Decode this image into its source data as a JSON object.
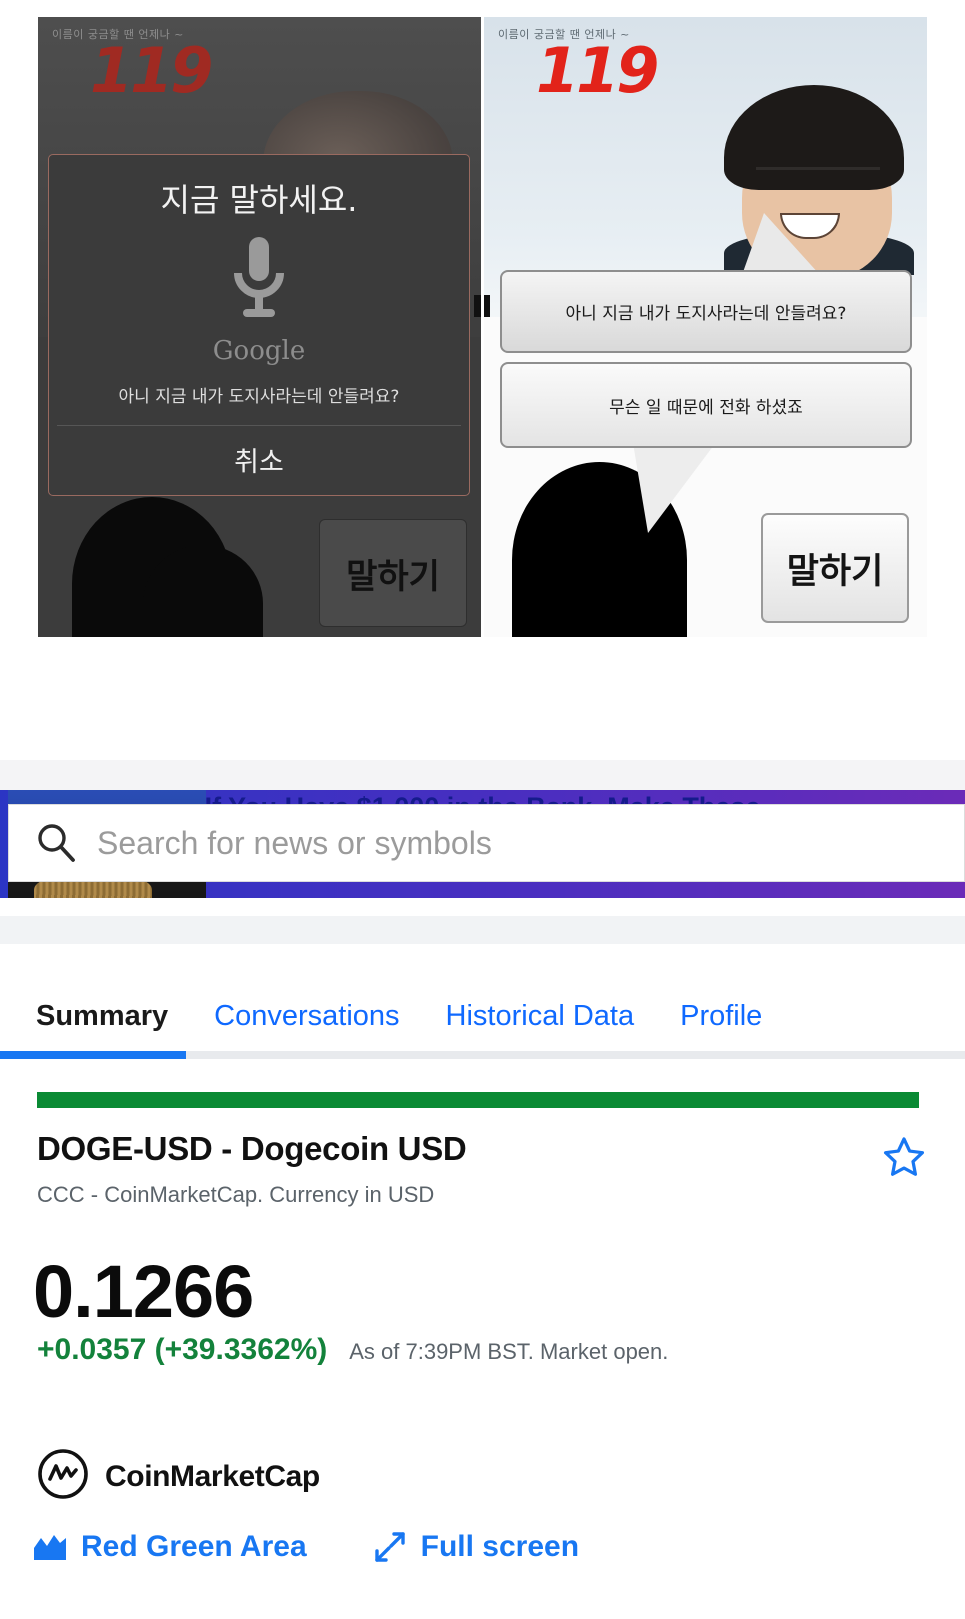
{
  "meme": {
    "left_panel": {
      "header_tagline": "이름이 궁금할 땐 언제나 ~",
      "logo": "119",
      "dialog": {
        "title": "지금 말하세요.",
        "brand": "Google",
        "mic_icon": "microphone-icon",
        "recognized_text": "아니 지금 내가 도지사라는데 안들려요?",
        "cancel_label": "취소"
      },
      "speak_button_label": "말하기"
    },
    "right_panel": {
      "header_tagline": "이름이 궁금할 땐 언제나 ~",
      "logo": "119",
      "bubbles": [
        "아니 지금 내가 도지사라는데 안들려요?",
        "무슨 일 때문에 전화 하셨죠"
      ],
      "speak_button_label": "말하기"
    }
  },
  "finance": {
    "ad": {
      "headline": "If You Have $1,000 in the Bank, Make These"
    },
    "search": {
      "placeholder": "Search for news or symbols",
      "value": "",
      "icon": "search-icon"
    },
    "tabs": [
      {
        "label": "Summary",
        "active": true
      },
      {
        "label": "Conversations",
        "active": false
      },
      {
        "label": "Historical Data",
        "active": false
      },
      {
        "label": "Profile",
        "active": false
      }
    ],
    "quote": {
      "title": "DOGE-USD - Dogecoin USD",
      "subtitle": "CCC - CoinMarketCap. Currency in USD",
      "price": "0.1266",
      "change": "+0.0357 (+39.3362%)",
      "as_of": "As of 7:39PM BST. Market open.",
      "star_icon": "star-outline-icon",
      "status_bar_color": "#0a8a34",
      "positive_color": "#13823b",
      "link_color": "#1877f2"
    },
    "attribution": {
      "provider": "CoinMarketCap",
      "logo_icon": "coinmarketcap-icon"
    },
    "chart_controls": [
      {
        "label": "Red Green Area",
        "icon": "area-chart-icon"
      },
      {
        "label": "Full screen",
        "icon": "fullscreen-icon"
      }
    ]
  }
}
